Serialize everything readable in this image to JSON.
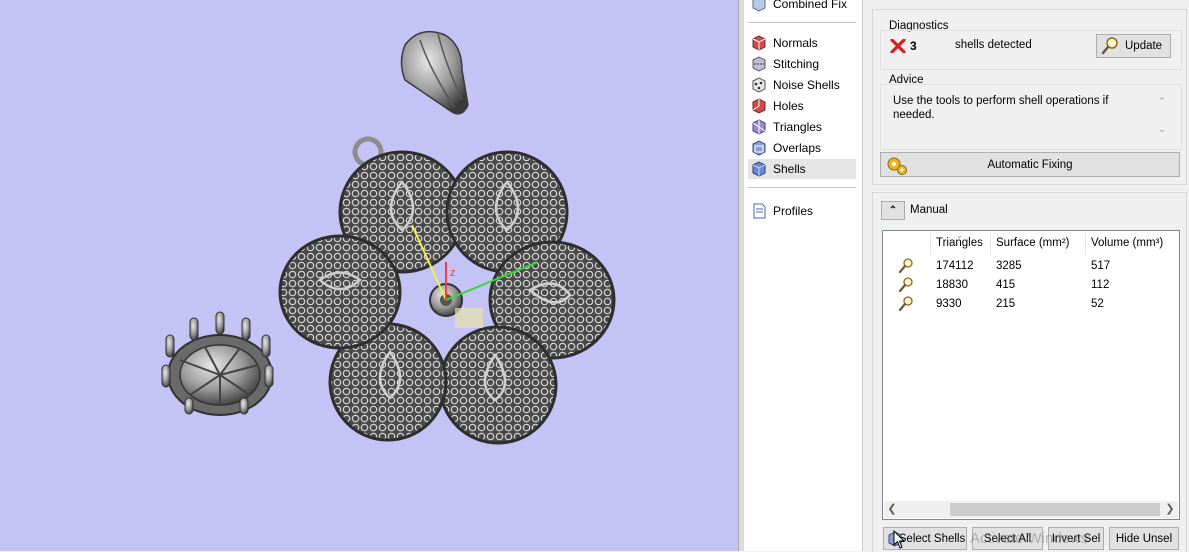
{
  "nav": {
    "combined_fix": "Combined Fix",
    "items": [
      {
        "label": "Normals",
        "icon": "normals-cube-icon"
      },
      {
        "label": "Stitching",
        "icon": "stitching-cube-icon"
      },
      {
        "label": "Noise Shells",
        "icon": "noise-shells-cube-icon"
      },
      {
        "label": "Holes",
        "icon": "holes-cube-icon"
      },
      {
        "label": "Triangles",
        "icon": "triangles-cube-icon"
      },
      {
        "label": "Overlaps",
        "icon": "overlaps-cube-icon"
      },
      {
        "label": "Shells",
        "icon": "shells-cube-icon",
        "selected": true
      }
    ],
    "profiles": "Profiles"
  },
  "diagnostics": {
    "title": "Diagnostics",
    "count": "3",
    "status_text": "shells detected",
    "status_icon": "red-x-icon",
    "update_button": "Update"
  },
  "advice": {
    "title": "Advice",
    "text": "Use the tools to perform shell operations if needed."
  },
  "automatic_fixing": "Automatic Fixing",
  "manual": {
    "title": "Manual",
    "columns": [
      "Triangles",
      "Surface (mm²)",
      "Volume (mm³)"
    ],
    "rows": [
      {
        "triangles": "174112",
        "surface": "3285",
        "volume": "517"
      },
      {
        "triangles": "18830",
        "surface": "415",
        "volume": "112"
      },
      {
        "triangles": "9330",
        "surface": "215",
        "volume": "52"
      }
    ]
  },
  "buttons": {
    "select_shells": "Select Shells",
    "select_all": "Select All",
    "invert_sel": "Invert Sel",
    "hide_unsel": "Hide Unsel"
  },
  "viewport": {
    "axis_label": "z",
    "background": "#c4c3f6"
  },
  "watermark": "Activate Windows"
}
